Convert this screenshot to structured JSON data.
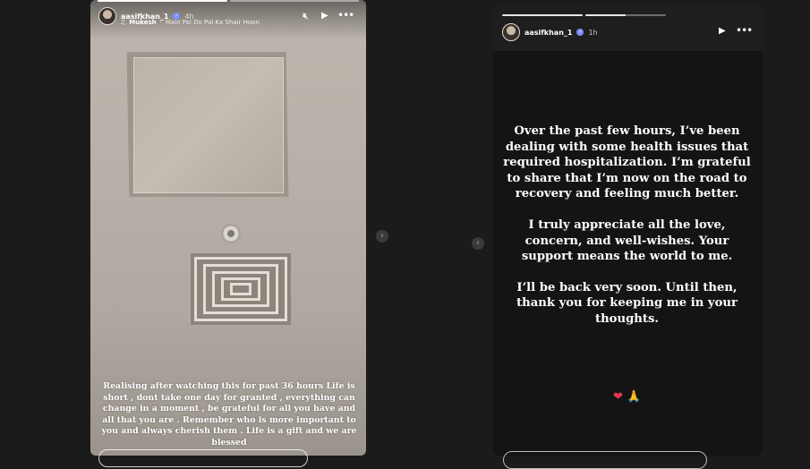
{
  "left_story": {
    "username": "aasifkhan_1",
    "time": "4h",
    "music": {
      "artist": "Mukesh",
      "song": "Main Pal Do Pal Ka Shair Hoon"
    },
    "icons": [
      "music-note-icon",
      "mute-icon",
      "play-icon",
      "more-icon"
    ],
    "caption": "Realising after watching this for past 36 hours Life is short , dont take one day for granted , everything can change in a moment , be grateful for all you have and all that you are . Remember who is more important to you and always cherish them . Life is a gift and we are blessed"
  },
  "nav": {
    "next_icon": "chevron-right-icon",
    "prev_icon": "chevron-left-icon"
  },
  "right_story": {
    "username": "aasifkhan_1",
    "time": "1h",
    "paragraphs": [
      "Over the past few hours, I’ve been dealing with some health issues that required hospitalization. I’m grateful to share that I’m now on the road to recovery and feeling much better.",
      "I truly appreciate all the love, concern, and well-wishes. Your support means the world to me.",
      "I’ll be back very soon. Until then, thank you for keeping me in your thoughts."
    ],
    "emojis": {
      "heart": "❤",
      "hands": "🙏"
    },
    "icons": [
      "play-icon",
      "more-icon"
    ]
  }
}
